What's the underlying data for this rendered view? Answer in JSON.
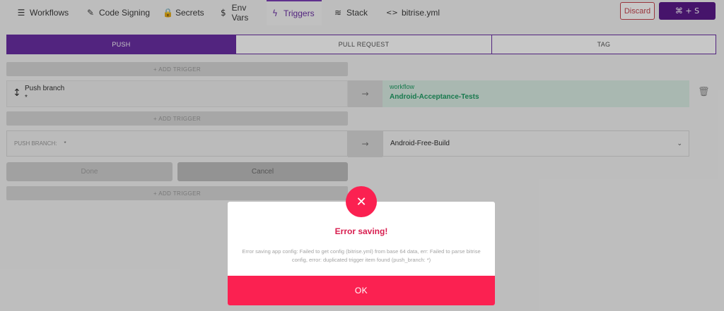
{
  "nav": {
    "tabs": [
      {
        "label": "Workflows",
        "icon": "list-icon",
        "glyph": "☰"
      },
      {
        "label": "Code Signing",
        "icon": "code-signing-icon",
        "glyph": "✎"
      },
      {
        "label": "Secrets",
        "icon": "lock-icon",
        "glyph": "🔒"
      },
      {
        "label": "Env Vars",
        "icon": "dollar-icon",
        "glyph": "$"
      },
      {
        "label": "Triggers",
        "icon": "bolt-icon",
        "glyph": "ϟ"
      },
      {
        "label": "Stack",
        "icon": "layers-icon",
        "glyph": "≋"
      },
      {
        "label": "bitrise.yml",
        "icon": "code-icon",
        "glyph": "<>"
      }
    ],
    "active_tab": "Triggers",
    "discard_label": "Discard",
    "save_label": "⌘ + S"
  },
  "segments": [
    "PUSH",
    "PULL REQUEST",
    "TAG"
  ],
  "active_segment": "PUSH",
  "add_trigger_label": "+ ADD TRIGGER",
  "existing_trigger": {
    "title": "Push branch",
    "pattern": "*",
    "arrow": "→",
    "workflow_label": "workflow",
    "workflow_name": "Android-Acceptance-Tests"
  },
  "edit_trigger": {
    "field_label": "PUSH BRANCH:",
    "field_value": "*",
    "arrow": "→",
    "selected_workflow": "Android-Free-Build",
    "done_label": "Done",
    "cancel_label": "Cancel"
  },
  "modal": {
    "icon": "close-icon",
    "title": "Error saving!",
    "message": "Error saving app config: Failed to get config (bitrise.yml) from base 64 data, err: Failed to parse bitrise config, error: duplicated trigger item found (push_branch: *)",
    "ok_label": "OK"
  },
  "colors": {
    "brand_purple": "#6a2fa3",
    "error_red": "#fb2151",
    "workflow_green": "#1e9c63"
  }
}
